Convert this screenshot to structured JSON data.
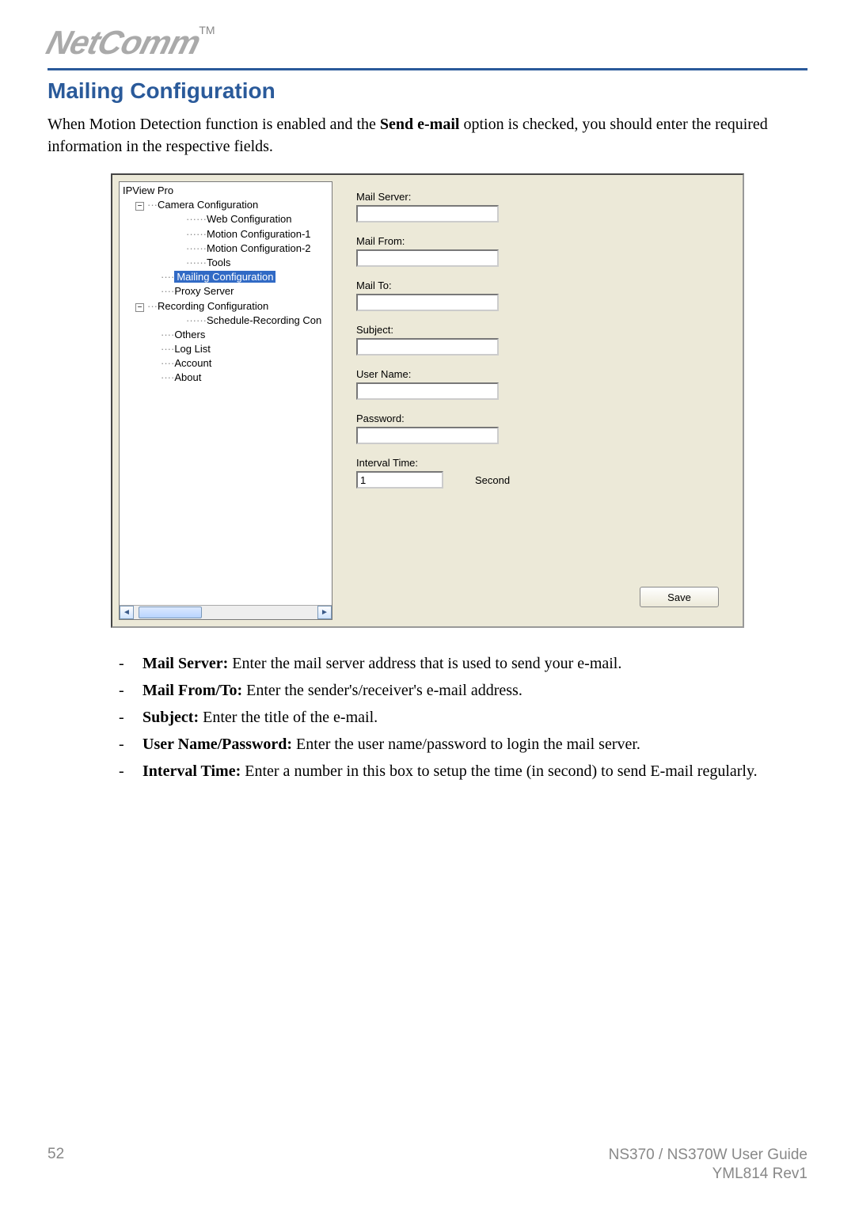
{
  "brand": "NetComm",
  "tm": "TM",
  "heading": "Mailing Configuration",
  "intro_prefix": "When Motion Detection function is enabled and the ",
  "intro_bold": "Send e-mail",
  "intro_suffix": " option is checked, you should enter the required information in the respective fields.",
  "tree": {
    "root": "IPView Pro",
    "camera_cfg": "Camera Configuration",
    "web_cfg": "Web Configuration",
    "motion1": "Motion Configuration-1",
    "motion2": "Motion Configuration-2",
    "tools": "Tools",
    "mailing": "Mailing Configuration",
    "proxy": "Proxy Server",
    "recording": "Recording Configuration",
    "schedule": "Schedule-Recording Con",
    "others": "Others",
    "loglist": "Log List",
    "account": "Account",
    "about": "About"
  },
  "form": {
    "mail_server_label": "Mail Server:",
    "mail_server_value": "",
    "mail_from_label": "Mail From:",
    "mail_from_value": "",
    "mail_to_label": "Mail To:",
    "mail_to_value": "",
    "subject_label": "Subject:",
    "subject_value": "",
    "username_label": "User Name:",
    "username_value": "",
    "password_label": "Password:",
    "password_value": "",
    "interval_label": "Interval Time:",
    "interval_value": "1",
    "interval_unit": "Second",
    "save_label": "Save"
  },
  "descriptions": [
    {
      "bold": "Mail Server:",
      "text": " Enter the mail server address that is used to send your e-mail."
    },
    {
      "bold": "Mail From/To:",
      "text": " Enter the sender's/receiver's e-mail address."
    },
    {
      "bold": "Subject:",
      "text": " Enter the title of the e-mail."
    },
    {
      "bold": "User Name/Password:",
      "text": " Enter the user name/password to login the mail server."
    },
    {
      "bold": "Interval Time:",
      "text": " Enter a number in this box to setup the time (in second) to send E-mail regularly."
    }
  ],
  "footer": {
    "page": "52",
    "line1": "NS370 / NS370W User Guide",
    "line2": "YML814 Rev1"
  }
}
